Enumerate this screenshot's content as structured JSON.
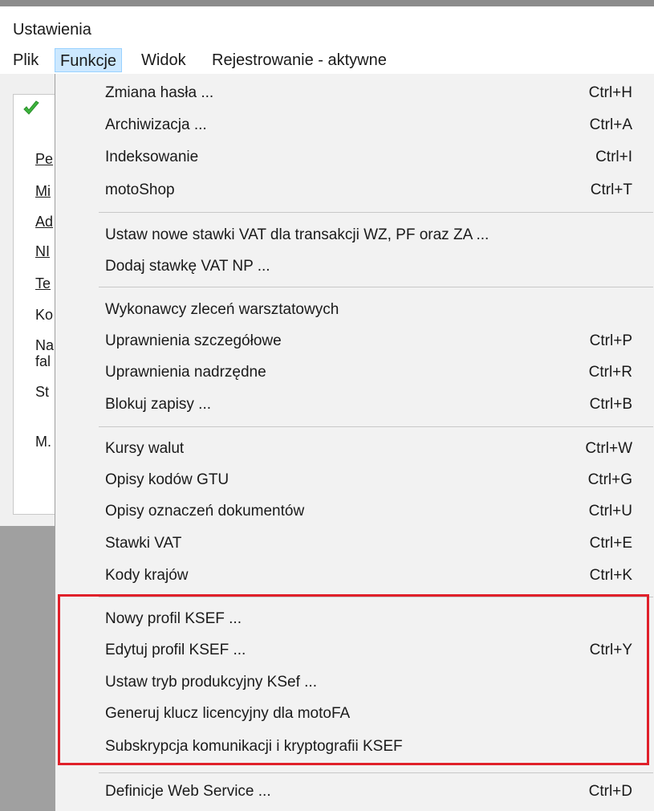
{
  "window": {
    "title": "Ustawienia"
  },
  "menubar": {
    "items": [
      {
        "label": "Plik"
      },
      {
        "label": "Funkcje"
      },
      {
        "label": "Widok"
      },
      {
        "label": "Rejestrowanie - aktywne"
      }
    ]
  },
  "panel": {
    "labels": [
      "Pe",
      "Mi",
      "Ad",
      "NI",
      "Te",
      "Ko",
      "Na",
      "fal",
      "St",
      "M."
    ]
  },
  "menu": {
    "items": [
      {
        "label": "Zmiana hasła ...",
        "shortcut": "Ctrl+H"
      },
      {
        "label": "Archiwizacja ...",
        "shortcut": "Ctrl+A"
      },
      {
        "label": "Indeksowanie",
        "shortcut": "Ctrl+I"
      },
      {
        "label": "motoShop",
        "shortcut": "Ctrl+T"
      },
      {
        "label": "Ustaw nowe stawki VAT dla transakcji WZ, PF oraz ZA ...",
        "shortcut": ""
      },
      {
        "label": "Dodaj stawkę VAT NP ...",
        "shortcut": ""
      },
      {
        "label": "Wykonawcy zleceń warsztatowych",
        "shortcut": ""
      },
      {
        "label": "Uprawnienia szczegółowe",
        "shortcut": "Ctrl+P"
      },
      {
        "label": "Uprawnienia nadrzędne",
        "shortcut": "Ctrl+R"
      },
      {
        "label": "Blokuj zapisy ...",
        "shortcut": "Ctrl+B"
      },
      {
        "label": "Kursy walut",
        "shortcut": "Ctrl+W"
      },
      {
        "label": "Opisy kodów GTU",
        "shortcut": "Ctrl+G"
      },
      {
        "label": "Opisy oznaczeń dokumentów",
        "shortcut": "Ctrl+U"
      },
      {
        "label": "Stawki VAT",
        "shortcut": "Ctrl+E"
      },
      {
        "label": "Kody krajów",
        "shortcut": "Ctrl+K"
      },
      {
        "label": "Nowy profil KSEF ...",
        "shortcut": ""
      },
      {
        "label": "Edytuj profil KSEF ...",
        "shortcut": "Ctrl+Y"
      },
      {
        "label": "Ustaw tryb produkcyjny KSef ...",
        "shortcut": ""
      },
      {
        "label": "Generuj klucz licencyjny dla motoFA",
        "shortcut": ""
      },
      {
        "label": "Subskrypcja komunikacji i kryptografii KSEF",
        "shortcut": ""
      },
      {
        "label": "Definicje Web Service ...",
        "shortcut": "Ctrl+D"
      }
    ]
  },
  "colors": {
    "highlight_border": "#e0202a",
    "menubar_active": "#cce8ff",
    "check_icon": "#3cb43c"
  }
}
